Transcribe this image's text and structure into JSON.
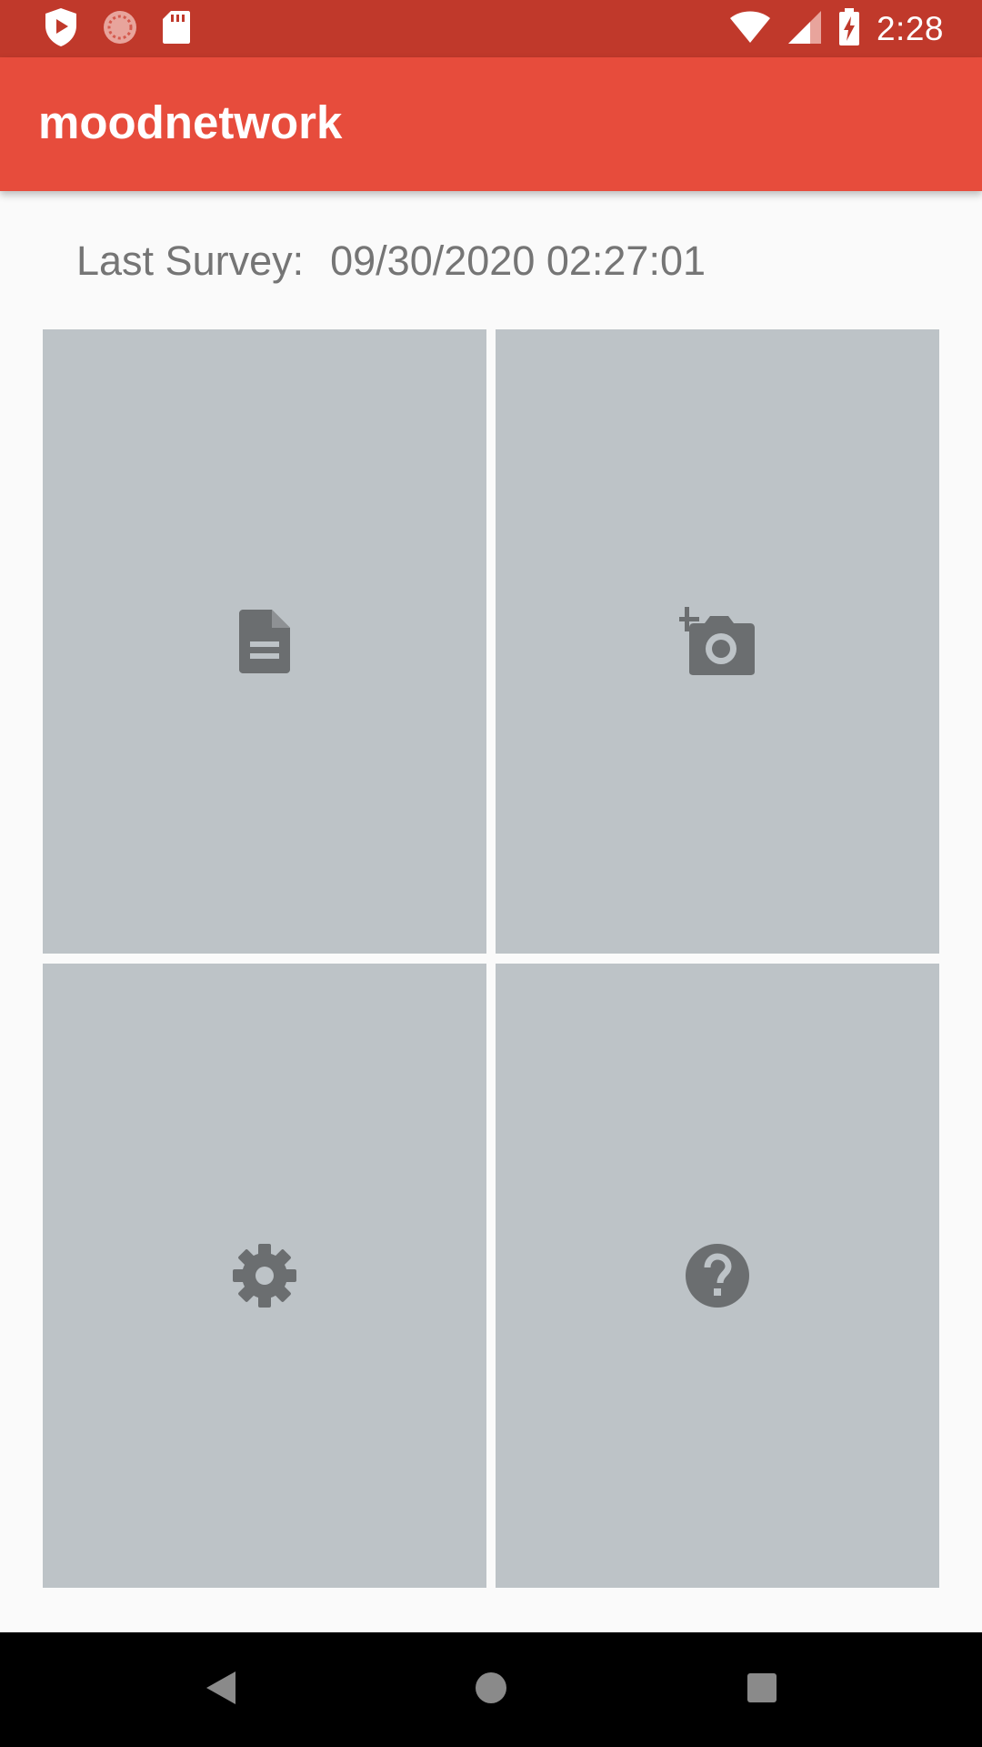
{
  "status_bar": {
    "time": "2:28",
    "left_icons": [
      "shield-play-icon",
      "sync-circle-icon",
      "sd-card-icon"
    ],
    "right_icons": [
      "wifi-icon",
      "signal-icon",
      "battery-charging-icon"
    ],
    "background": "#c0392b"
  },
  "app_bar": {
    "title": "moodnetwork",
    "background": "#e74c3c"
  },
  "survey": {
    "label": "Last Survey:",
    "value": "09/30/2020 02:27:01"
  },
  "tiles": [
    {
      "icon": "document-icon"
    },
    {
      "icon": "add-photo-icon"
    },
    {
      "icon": "settings-icon"
    },
    {
      "icon": "help-icon"
    }
  ],
  "colors": {
    "tile_background": "#bdc3c7",
    "icon_color": "#6b6e70"
  },
  "nav_bar": {
    "buttons": [
      "back-icon",
      "home-icon",
      "recents-icon"
    ]
  }
}
